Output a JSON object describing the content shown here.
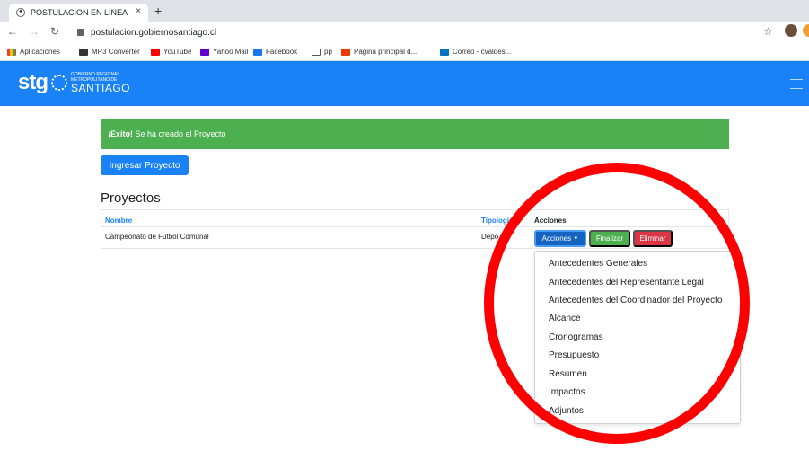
{
  "browser": {
    "tab_title": "POSTULACION EN LÍNEA",
    "tab_close": "×",
    "new_tab": "+",
    "url": "postulacion.gobiernosantiago.cl",
    "bookmarks": [
      {
        "label": "Aplicaciones"
      },
      {
        "label": "MP3 Converter"
      },
      {
        "label": "YouTube"
      },
      {
        "label": "Yahoo Mail"
      },
      {
        "label": "Facebook"
      },
      {
        "label": "pp"
      },
      {
        "label": "Página principal d..."
      },
      {
        "label": "Correo - cvaldes..."
      }
    ]
  },
  "site": {
    "logo_stg": "stg",
    "logo_line1": "GOBIERNO REGIONAL",
    "logo_line2": "METROPOLITANO DE",
    "logo_line3": "SANTIAGO",
    "nav_color": "#1a82f7"
  },
  "alert": {
    "strong": "¡Exito!",
    "text": " Se ha creado el Proyecto",
    "color": "#4caf50"
  },
  "ingresar_button": "Ingresar Proyecto",
  "section_title": "Proyectos",
  "table": {
    "headers": [
      "Nombre",
      "Tipología",
      "Acciones"
    ],
    "rows": [
      {
        "nombre": "Campeonato de Futbol Comunal",
        "tipologia": "Depo"
      }
    ]
  },
  "actions": {
    "acciones": "Acciones",
    "finalizar": "Finalizar",
    "eliminar": "Eliminar"
  },
  "dropdown": [
    "Antecedentes Generales",
    "Antecedentes del Representante Legal",
    "Antecedentes del Coordinador del Proyecto",
    "Alcance",
    "Cronogramas",
    "Presupuesto",
    "Resumen",
    "Impactos",
    "Adjuntos"
  ],
  "annotation_color": "#ff0000"
}
